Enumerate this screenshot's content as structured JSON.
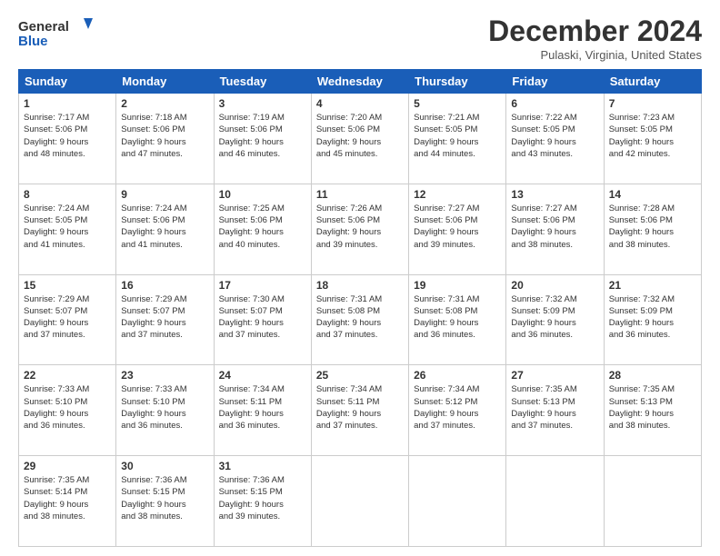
{
  "header": {
    "logo_line1": "General",
    "logo_line2": "Blue",
    "month": "December 2024",
    "location": "Pulaski, Virginia, United States"
  },
  "days_of_week": [
    "Sunday",
    "Monday",
    "Tuesday",
    "Wednesday",
    "Thursday",
    "Friday",
    "Saturday"
  ],
  "weeks": [
    [
      {
        "day": "1",
        "lines": [
          "Sunrise: 7:17 AM",
          "Sunset: 5:06 PM",
          "Daylight: 9 hours",
          "and 48 minutes."
        ]
      },
      {
        "day": "2",
        "lines": [
          "Sunrise: 7:18 AM",
          "Sunset: 5:06 PM",
          "Daylight: 9 hours",
          "and 47 minutes."
        ]
      },
      {
        "day": "3",
        "lines": [
          "Sunrise: 7:19 AM",
          "Sunset: 5:06 PM",
          "Daylight: 9 hours",
          "and 46 minutes."
        ]
      },
      {
        "day": "4",
        "lines": [
          "Sunrise: 7:20 AM",
          "Sunset: 5:06 PM",
          "Daylight: 9 hours",
          "and 45 minutes."
        ]
      },
      {
        "day": "5",
        "lines": [
          "Sunrise: 7:21 AM",
          "Sunset: 5:05 PM",
          "Daylight: 9 hours",
          "and 44 minutes."
        ]
      },
      {
        "day": "6",
        "lines": [
          "Sunrise: 7:22 AM",
          "Sunset: 5:05 PM",
          "Daylight: 9 hours",
          "and 43 minutes."
        ]
      },
      {
        "day": "7",
        "lines": [
          "Sunrise: 7:23 AM",
          "Sunset: 5:05 PM",
          "Daylight: 9 hours",
          "and 42 minutes."
        ]
      }
    ],
    [
      {
        "day": "8",
        "lines": [
          "Sunrise: 7:24 AM",
          "Sunset: 5:05 PM",
          "Daylight: 9 hours",
          "and 41 minutes."
        ]
      },
      {
        "day": "9",
        "lines": [
          "Sunrise: 7:24 AM",
          "Sunset: 5:06 PM",
          "Daylight: 9 hours",
          "and 41 minutes."
        ]
      },
      {
        "day": "10",
        "lines": [
          "Sunrise: 7:25 AM",
          "Sunset: 5:06 PM",
          "Daylight: 9 hours",
          "and 40 minutes."
        ]
      },
      {
        "day": "11",
        "lines": [
          "Sunrise: 7:26 AM",
          "Sunset: 5:06 PM",
          "Daylight: 9 hours",
          "and 39 minutes."
        ]
      },
      {
        "day": "12",
        "lines": [
          "Sunrise: 7:27 AM",
          "Sunset: 5:06 PM",
          "Daylight: 9 hours",
          "and 39 minutes."
        ]
      },
      {
        "day": "13",
        "lines": [
          "Sunrise: 7:27 AM",
          "Sunset: 5:06 PM",
          "Daylight: 9 hours",
          "and 38 minutes."
        ]
      },
      {
        "day": "14",
        "lines": [
          "Sunrise: 7:28 AM",
          "Sunset: 5:06 PM",
          "Daylight: 9 hours",
          "and 38 minutes."
        ]
      }
    ],
    [
      {
        "day": "15",
        "lines": [
          "Sunrise: 7:29 AM",
          "Sunset: 5:07 PM",
          "Daylight: 9 hours",
          "and 37 minutes."
        ]
      },
      {
        "day": "16",
        "lines": [
          "Sunrise: 7:29 AM",
          "Sunset: 5:07 PM",
          "Daylight: 9 hours",
          "and 37 minutes."
        ]
      },
      {
        "day": "17",
        "lines": [
          "Sunrise: 7:30 AM",
          "Sunset: 5:07 PM",
          "Daylight: 9 hours",
          "and 37 minutes."
        ]
      },
      {
        "day": "18",
        "lines": [
          "Sunrise: 7:31 AM",
          "Sunset: 5:08 PM",
          "Daylight: 9 hours",
          "and 37 minutes."
        ]
      },
      {
        "day": "19",
        "lines": [
          "Sunrise: 7:31 AM",
          "Sunset: 5:08 PM",
          "Daylight: 9 hours",
          "and 36 minutes."
        ]
      },
      {
        "day": "20",
        "lines": [
          "Sunrise: 7:32 AM",
          "Sunset: 5:09 PM",
          "Daylight: 9 hours",
          "and 36 minutes."
        ]
      },
      {
        "day": "21",
        "lines": [
          "Sunrise: 7:32 AM",
          "Sunset: 5:09 PM",
          "Daylight: 9 hours",
          "and 36 minutes."
        ]
      }
    ],
    [
      {
        "day": "22",
        "lines": [
          "Sunrise: 7:33 AM",
          "Sunset: 5:10 PM",
          "Daylight: 9 hours",
          "and 36 minutes."
        ]
      },
      {
        "day": "23",
        "lines": [
          "Sunrise: 7:33 AM",
          "Sunset: 5:10 PM",
          "Daylight: 9 hours",
          "and 36 minutes."
        ]
      },
      {
        "day": "24",
        "lines": [
          "Sunrise: 7:34 AM",
          "Sunset: 5:11 PM",
          "Daylight: 9 hours",
          "and 36 minutes."
        ]
      },
      {
        "day": "25",
        "lines": [
          "Sunrise: 7:34 AM",
          "Sunset: 5:11 PM",
          "Daylight: 9 hours",
          "and 37 minutes."
        ]
      },
      {
        "day": "26",
        "lines": [
          "Sunrise: 7:34 AM",
          "Sunset: 5:12 PM",
          "Daylight: 9 hours",
          "and 37 minutes."
        ]
      },
      {
        "day": "27",
        "lines": [
          "Sunrise: 7:35 AM",
          "Sunset: 5:13 PM",
          "Daylight: 9 hours",
          "and 37 minutes."
        ]
      },
      {
        "day": "28",
        "lines": [
          "Sunrise: 7:35 AM",
          "Sunset: 5:13 PM",
          "Daylight: 9 hours",
          "and 38 minutes."
        ]
      }
    ],
    [
      {
        "day": "29",
        "lines": [
          "Sunrise: 7:35 AM",
          "Sunset: 5:14 PM",
          "Daylight: 9 hours",
          "and 38 minutes."
        ]
      },
      {
        "day": "30",
        "lines": [
          "Sunrise: 7:36 AM",
          "Sunset: 5:15 PM",
          "Daylight: 9 hours",
          "and 38 minutes."
        ]
      },
      {
        "day": "31",
        "lines": [
          "Sunrise: 7:36 AM",
          "Sunset: 5:15 PM",
          "Daylight: 9 hours",
          "and 39 minutes."
        ]
      },
      null,
      null,
      null,
      null
    ]
  ]
}
